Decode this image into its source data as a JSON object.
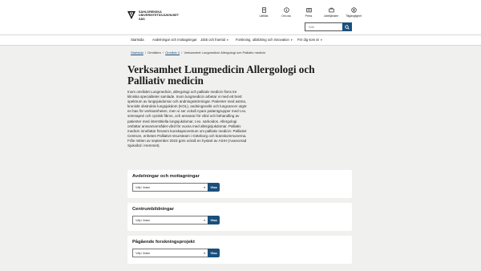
{
  "header": {
    "logo_lines": [
      "SAHLGRENSKA",
      "UNIVERSITETSSJUKHUSET",
      "SÄS"
    ],
    "tools": [
      {
        "label": "Lättläst",
        "icon": "document-icon"
      },
      {
        "label": "Om oss",
        "icon": "info-icon"
      },
      {
        "label": "Press",
        "icon": "newspaper-icon"
      },
      {
        "label": "Jobbtjänster",
        "icon": "briefcase-icon"
      },
      {
        "label": "Tillgänglighet",
        "icon": "accessibility-icon"
      }
    ],
    "search": {
      "placeholder": "Sök",
      "icon": "search-icon"
    }
  },
  "nav": {
    "items": [
      {
        "label": "Startsida",
        "dropdown": false
      },
      {
        "label": "Avdelningar och mottagningar",
        "dropdown": false
      },
      {
        "label": "Jobb och framtid",
        "dropdown": true
      },
      {
        "label": "Forskning, utbildning och innovation",
        "dropdown": true
      },
      {
        "label": "För dig som är",
        "dropdown": true
      }
    ]
  },
  "breadcrumb": {
    "items": [
      "Startsida",
      "Områden",
      "Område 4",
      "Verksamhet Lungmedicin Allergologi och Palliativ medicin"
    ]
  },
  "page": {
    "title": "Verksamhet Lungmedicin Allergologi och Palliativ medicin",
    "intro": "Inom området Lungmedicin, allergologi och palliativ medicin finns tre kliniska specialiteter samlade. Inom lungmedicin arbetar vi med ett brett spektrum av lungsjukdomar och andningsstörningar. Patienter med astma, kroniskt obstruktiv lungsjukdom (KOL), andningssvikt och lungcancer utgör en bas för verksamheten, men vi ser också nyare patientgrupper med t.ex. sömnapné och cystisk fibros, och ansvarar för vård och behandling av patienter med interstitiella lungsjukdomar, t.ex. sarkoidos. Allergologi omfattar ansvarsområdet vård för vuxna med allergisjukdomar. Palliativ medicin innefattar förutom kunskapscentrum om palliativ medicin: Palliativt Centrum, enheten Palliativt resursteam i Göteborg och kranskommunerna. Från mitten av september 2023 görs också en hystart av ASIH (Avancerad Sjukvård i Hemmet)."
  },
  "cards": [
    {
      "title": "Avdelningar och mottagningar",
      "select_value": "Välj i listan",
      "button_label": "Visa"
    },
    {
      "title": "Centrumbildningar",
      "select_value": "Välj i listan",
      "button_label": "Visa"
    },
    {
      "title": "Pågående forskningsprojekt",
      "select_value": "Välj i listan",
      "button_label": "Visa"
    }
  ],
  "colors": {
    "accent": "#1a4f7c",
    "background": "#f0f0ee",
    "card": "#ffffff"
  }
}
